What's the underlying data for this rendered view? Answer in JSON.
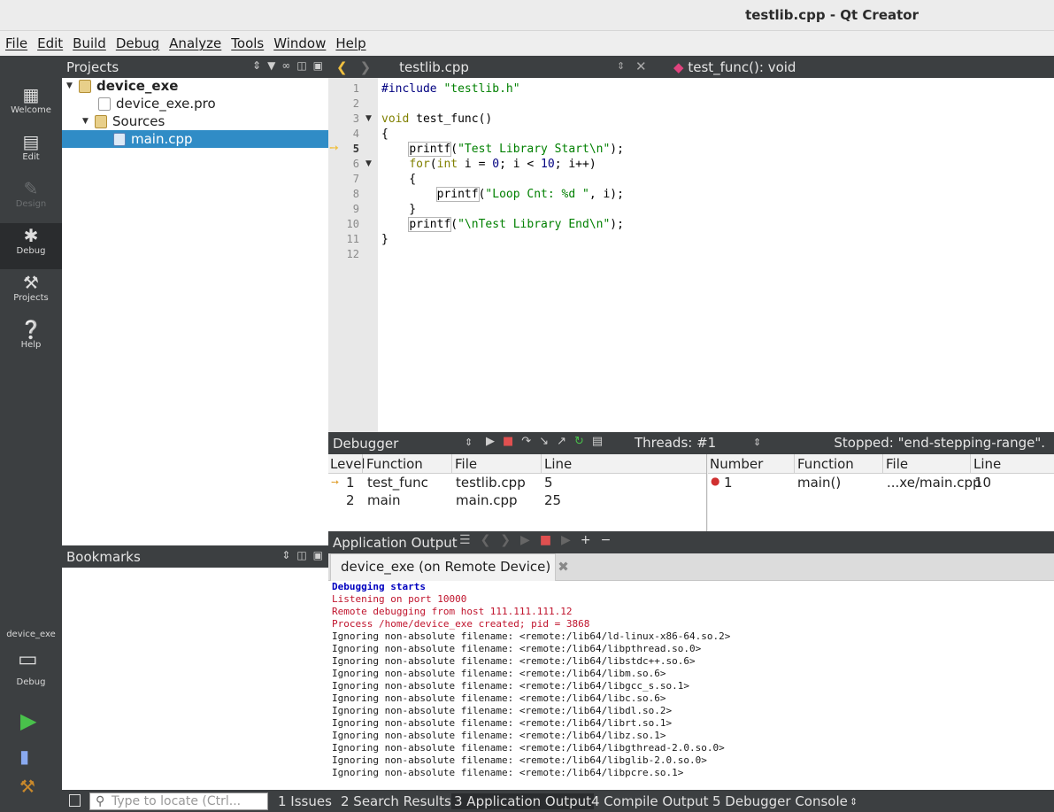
{
  "window": {
    "title": "testlib.cpp - Qt Creator"
  },
  "menu": [
    "File",
    "Edit",
    "Build",
    "Debug",
    "Analyze",
    "Tools",
    "Window",
    "Help"
  ],
  "modes": [
    {
      "label": "Welcome",
      "icon": "grid-icon"
    },
    {
      "label": "Edit",
      "icon": "document-icon"
    },
    {
      "label": "Design",
      "icon": "pencil-icon"
    },
    {
      "label": "Debug",
      "icon": "bug-icon"
    },
    {
      "label": "Projects",
      "icon": "wrench-icon"
    },
    {
      "label": "Help",
      "icon": "help-icon"
    }
  ],
  "projects": {
    "title": "Projects",
    "tree": [
      {
        "label": "device_exe",
        "bold": true
      },
      {
        "label": "device_exe.pro"
      },
      {
        "label": "Sources"
      },
      {
        "label": "main.cpp",
        "selected": true
      }
    ]
  },
  "bookmarks": {
    "title": "Bookmarks"
  },
  "editor": {
    "file": "testlib.cpp",
    "symbol": "test_func(): void",
    "line_numbers": [
      "1",
      "2",
      "3",
      "4",
      "5",
      "6",
      "7",
      "8",
      "9",
      "10",
      "11",
      "12"
    ],
    "current_line": 5
  },
  "debugger": {
    "title": "Debugger",
    "threads": "Threads: #1",
    "status": "Stopped: \"end-stepping-range\".",
    "stack": {
      "columns": [
        "Level",
        "Function",
        "File",
        "Line"
      ],
      "rows": [
        [
          "1",
          "test_func",
          "testlib.cpp",
          "5"
        ],
        [
          "2",
          "main",
          "main.cpp",
          "25"
        ]
      ]
    },
    "breakpoints": {
      "columns": [
        "Number",
        "Function",
        "File",
        "Line"
      ],
      "rows": [
        [
          "1",
          "main()",
          "...xe/main.cpp",
          "10"
        ]
      ]
    }
  },
  "output": {
    "title": "Application Output",
    "tab": "device_exe (on Remote Device)",
    "lines": [
      {
        "text": "Debugging starts",
        "kind": "blue"
      },
      {
        "text": "Listening on port 10000",
        "kind": "red"
      },
      {
        "text": "Remote debugging from host 111.111.111.12",
        "kind": "red"
      },
      {
        "text": "Process /home/device_exe created; pid = 3868",
        "kind": "red"
      },
      {
        "text": "Ignoring non-absolute filename: <remote:/lib64/ld-linux-x86-64.so.2>",
        "kind": "normal"
      },
      {
        "text": "Ignoring non-absolute filename: <remote:/lib64/libpthread.so.0>",
        "kind": "normal"
      },
      {
        "text": "Ignoring non-absolute filename: <remote:/lib64/libstdc++.so.6>",
        "kind": "normal"
      },
      {
        "text": "Ignoring non-absolute filename: <remote:/lib64/libm.so.6>",
        "kind": "normal"
      },
      {
        "text": "Ignoring non-absolute filename: <remote:/lib64/libgcc_s.so.1>",
        "kind": "normal"
      },
      {
        "text": "Ignoring non-absolute filename: <remote:/lib64/libc.so.6>",
        "kind": "normal"
      },
      {
        "text": "Ignoring non-absolute filename: <remote:/lib64/libdl.so.2>",
        "kind": "normal"
      },
      {
        "text": "Ignoring non-absolute filename: <remote:/lib64/librt.so.1>",
        "kind": "normal"
      },
      {
        "text": "Ignoring non-absolute filename: <remote:/lib64/libz.so.1>",
        "kind": "normal"
      },
      {
        "text": "Ignoring non-absolute filename: <remote:/lib64/libgthread-2.0.so.0>",
        "kind": "normal"
      },
      {
        "text": "Ignoring non-absolute filename: <remote:/lib64/libglib-2.0.so.0>",
        "kind": "normal"
      },
      {
        "text": "Ignoring non-absolute filename: <remote:/lib64/libpcre.so.1>",
        "kind": "normal"
      }
    ]
  },
  "kit": {
    "name": "device_exe",
    "label": "Debug"
  },
  "statusbar": {
    "search_placeholder": "Type to locate (Ctrl...",
    "tabs": [
      "1  Issues",
      "2  Search Results",
      "3  Application Output",
      "4  Compile Output",
      "5  Debugger Console"
    ],
    "active_tab": "3  Application Output"
  }
}
